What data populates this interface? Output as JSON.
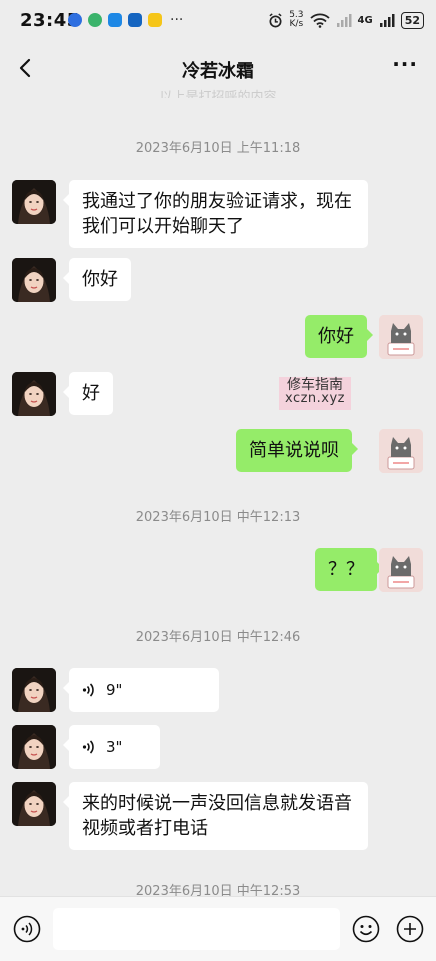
{
  "status_bar": {
    "time": "23:45",
    "net_speed_value": "5.3",
    "net_speed_unit": "K/s",
    "signal_label": "4G",
    "battery": "52"
  },
  "header": {
    "title": "冷若冰霜",
    "faded_text": "以上是打招呼的内容"
  },
  "messages": {
    "ts1": "2023年6月10日 上午11:18",
    "m1": "我通过了你的朋友验证请求，现在我们可以开始聊天了",
    "m2": "你好",
    "m3": "你好",
    "m4": "好",
    "m5": "简单说说呗",
    "ts2": "2023年6月10日 中午12:13",
    "m6": "？？",
    "ts3": "2023年6月10日 中午12:46",
    "v1": "9\"",
    "v2": "3\"",
    "m7": "来的时候说一声没回信息就发语音视频或者打电话",
    "ts4": "2023年6月10日 中午12:53"
  },
  "watermark": {
    "line1": "修车指南",
    "line2": "xczn.xyz"
  },
  "icons": {
    "back": "chevron-left-icon",
    "menu": "more-icon",
    "voice": "voice-icon",
    "emoji": "emoji-icon",
    "plus": "plus-icon"
  },
  "colors": {
    "outgoing_bubble": "#95ec69",
    "incoming_bubble": "#ffffff",
    "background": "#ededed"
  }
}
